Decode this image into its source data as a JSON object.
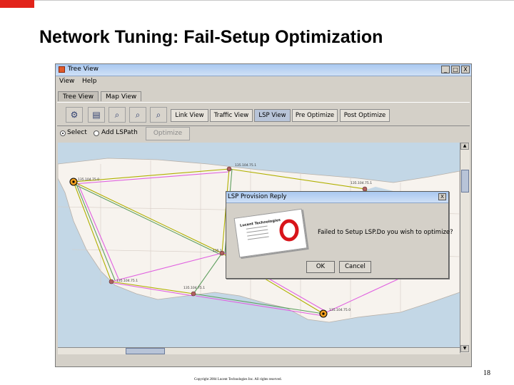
{
  "slide": {
    "title": "Network Tuning: Fail-Setup Optimization",
    "page_number": "18",
    "copyright": "Copyright 2004 Lucent Technologies Inc. All rights reserved.",
    "accent_color": "#e2231a"
  },
  "window": {
    "title": "Tree View",
    "controls": [
      "_",
      "□",
      "X"
    ]
  },
  "menu": [
    "View",
    "Help"
  ],
  "tabs": [
    {
      "label": "Tree View",
      "active": false
    },
    {
      "label": "Map View",
      "active": true
    }
  ],
  "toolbar": {
    "icons": [
      "select-tool-icon",
      "print-icon",
      "zoom-in-icon",
      "zoom-out-icon",
      "zoom-fit-icon"
    ],
    "views": [
      {
        "label": "Link View",
        "active": false
      },
      {
        "label": "Traffic View",
        "active": false
      },
      {
        "label": "LSP View",
        "active": true
      },
      {
        "label": "Pre Optimize",
        "active": false
      },
      {
        "label": "Post Optimize",
        "active": false
      }
    ]
  },
  "options": {
    "select_label": "Select",
    "add_lsp_label": "Add LSPath",
    "optimize_label": "Optimize",
    "selected": "Select"
  },
  "map": {
    "node_labels": [
      "135.104.75.1",
      "135.104.75.0",
      "135.104.75.1",
      "135.1",
      "135.104.75.1",
      "135.104.75.1",
      "135.104.75.0"
    ]
  },
  "dialog": {
    "title": "LSP Provision Reply",
    "close": "X",
    "logo_text": "Lucent Technologies",
    "message": "Failed to Setup LSP.Do you wish to optimize?",
    "ok_label": "OK",
    "cancel_label": "Cancel"
  }
}
